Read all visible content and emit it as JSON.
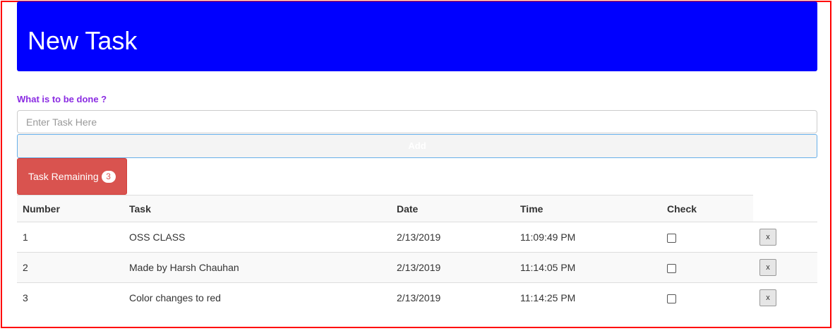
{
  "header": {
    "title": "New Task"
  },
  "form": {
    "question": "What is to be done ?",
    "placeholder": "Enter Task Here",
    "add_label": "Add"
  },
  "remaining": {
    "label": "Task Remaining",
    "count": "3"
  },
  "table": {
    "headers": {
      "number": "Number",
      "task": "Task",
      "date": "Date",
      "time": "Time",
      "check": "Check"
    },
    "rows": [
      {
        "number": "1",
        "task": "OSS CLASS",
        "date": "2/13/2019",
        "time": "11:09:49 PM",
        "checked": false,
        "remove": "x"
      },
      {
        "number": "2",
        "task": "Made by Harsh Chauhan",
        "date": "2/13/2019",
        "time": "11:14:05 PM",
        "checked": false,
        "remove": "x"
      },
      {
        "number": "3",
        "task": "Color changes to red",
        "date": "2/13/2019",
        "time": "11:14:25 PM",
        "checked": false,
        "remove": "x"
      }
    ]
  },
  "colors": {
    "header_bg": "#0000ff",
    "frame_border": "#ff0000",
    "question_text": "#8a2be2",
    "remaining_bg": "#d9534f"
  }
}
